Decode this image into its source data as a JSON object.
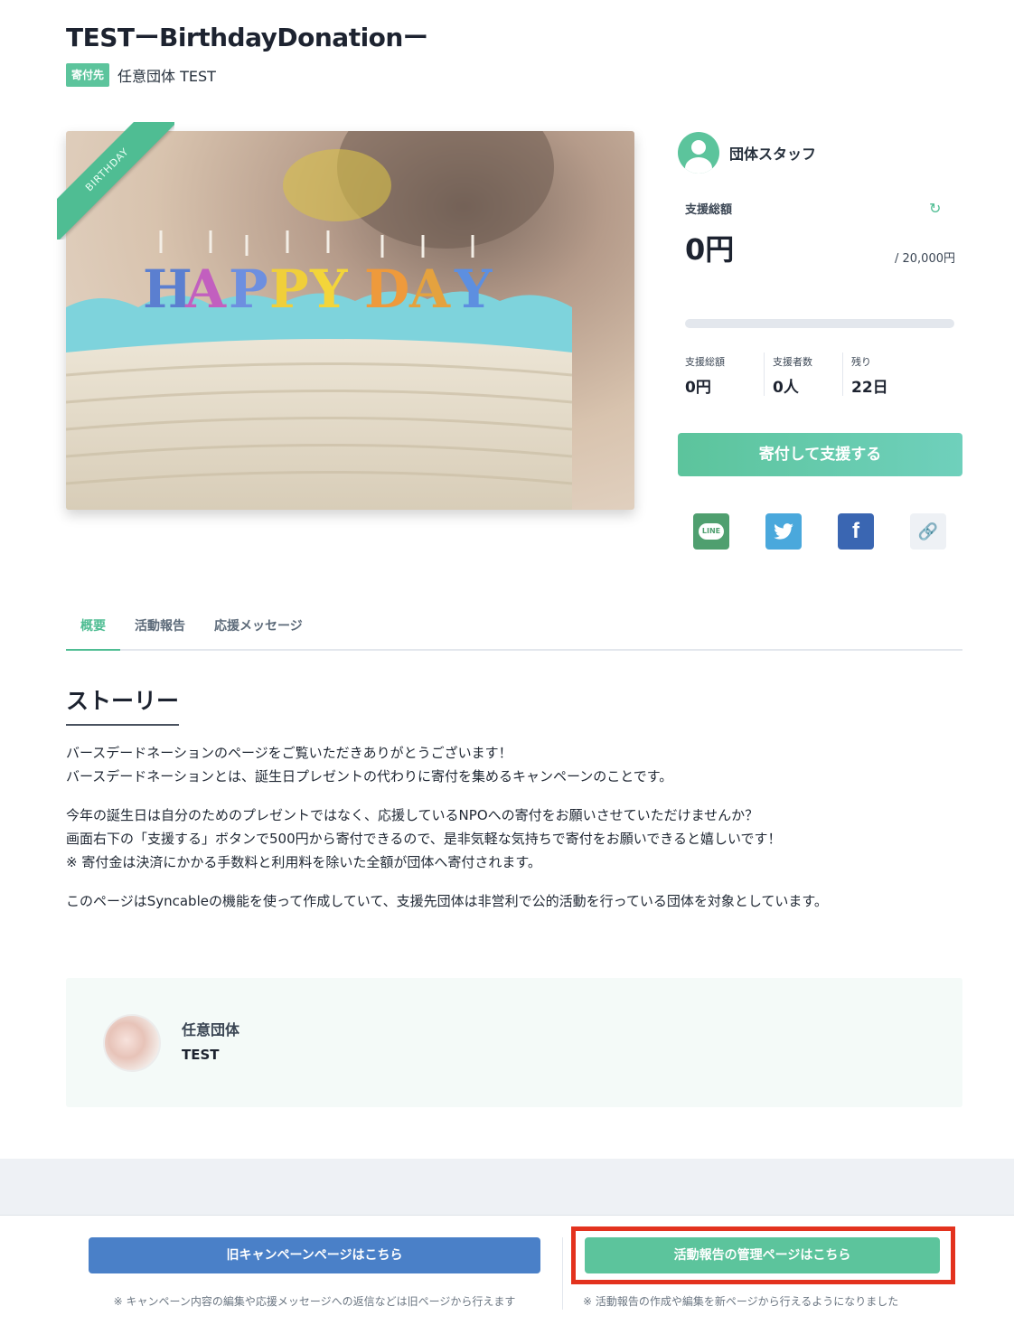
{
  "campaign": {
    "title": "TESTーBirthdayDonationー",
    "recipient_tag": "寄付先",
    "recipient_name": "任意団体 TEST",
    "ribbon": "BIRTHDAY"
  },
  "sidebar": {
    "staff_label": "団体スタッフ",
    "total_label": "支援総額",
    "total_value": "0円",
    "goal": "/ 20,000円",
    "progress_fraction": 0,
    "stats": [
      {
        "label": "支援総額",
        "value": "0円"
      },
      {
        "label": "支援者数",
        "value": "0人"
      },
      {
        "label": "残り",
        "value": "22日"
      }
    ],
    "donate_label": "寄付して支援する",
    "share_line": "LINE"
  },
  "tabs": [
    "概要",
    "活動報告",
    "応援メッセージ"
  ],
  "story": {
    "heading": "ストーリー",
    "paragraphs": [
      "バースデードネーションのページをご覧いただきありがとうございます！\nバースデードネーションとは、誕生日プレゼントの代わりに寄付を集めるキャンペーンのことです。",
      "今年の誕生日は自分のためのプレゼントではなく、応援しているNPOへの寄付をお願いさせていただけませんか？\n画面右下の「支援する」ボタンで500円から寄付できるので、是非気軽な気持ちで寄付をお願いできると嬉しいです！\n※ 寄付金は決済にかかる手数料と利用料を除いた全額が団体へ寄付されます。",
      "このページはSyncableの機能を使って作成していて、支援先団体は非営利で公的活動を行っている団体を対象としています。"
    ]
  },
  "org_card": {
    "line1": "任意団体",
    "line2": "TEST"
  },
  "bottom": {
    "old_button": "旧キャンペーンページはこちら",
    "old_note": "※ キャンペーン内容の編集や応援メッセージへの返信などは旧ページから行えます",
    "new_button": "活動報告の管理ページはこちら",
    "new_note": "※ 活動報告の作成や編集を新ページから行えるようになりました"
  },
  "colors": {
    "accent": "#5cc49c",
    "blue_button": "#4a80c8",
    "highlight": "#e3321e"
  }
}
